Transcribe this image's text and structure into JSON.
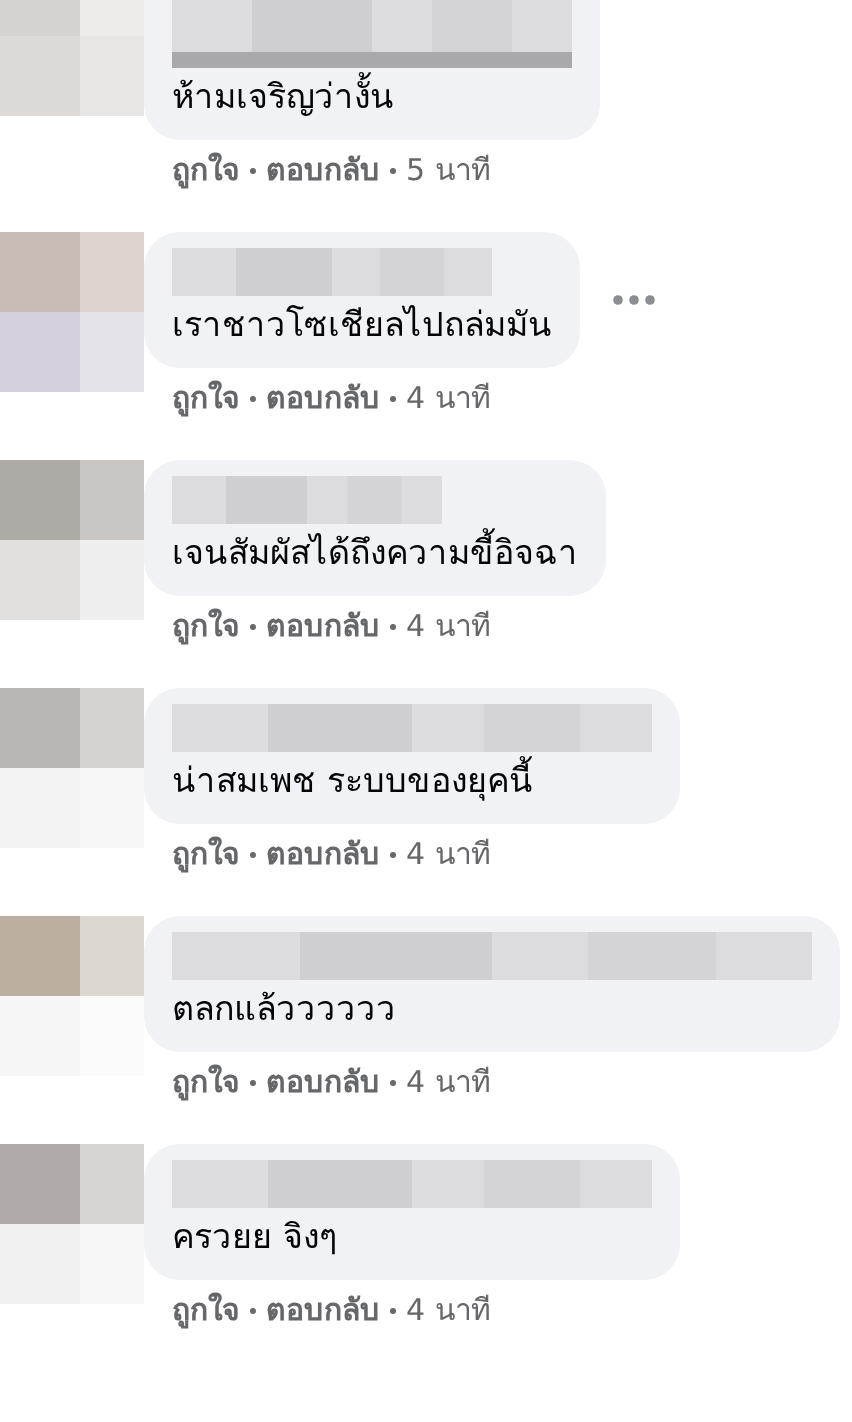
{
  "comments": [
    {
      "text": "ห้ามเจริญว่างั้น",
      "like": "ถูกใจ",
      "reply": "ตอบกลับ",
      "time": "5 นาที",
      "has_menu": false
    },
    {
      "text": "เราชาวโซเชียลไปถล่มมัน",
      "like": "ถูกใจ",
      "reply": "ตอบกลับ",
      "time": "4 นาที",
      "has_menu": true
    },
    {
      "text": "เจนสัมผัสได้ถึงความขี้อิจฉา",
      "like": "ถูกใจ",
      "reply": "ตอบกลับ",
      "time": "4 นาที",
      "has_menu": false
    },
    {
      "text": "น่าสมเพช ระบบของยุคนี้",
      "like": "ถูกใจ",
      "reply": "ตอบกลับ",
      "time": "4 นาที",
      "has_menu": false
    },
    {
      "text": "ตลกแล้วววววว",
      "like": "ถูกใจ",
      "reply": "ตอบกลับ",
      "time": "4 นาที",
      "has_menu": false
    },
    {
      "text": "ครวยย จิงๆ",
      "like": "ถูกใจ",
      "reply": "ตอบกลับ",
      "time": "4 นาที",
      "has_menu": false
    }
  ]
}
